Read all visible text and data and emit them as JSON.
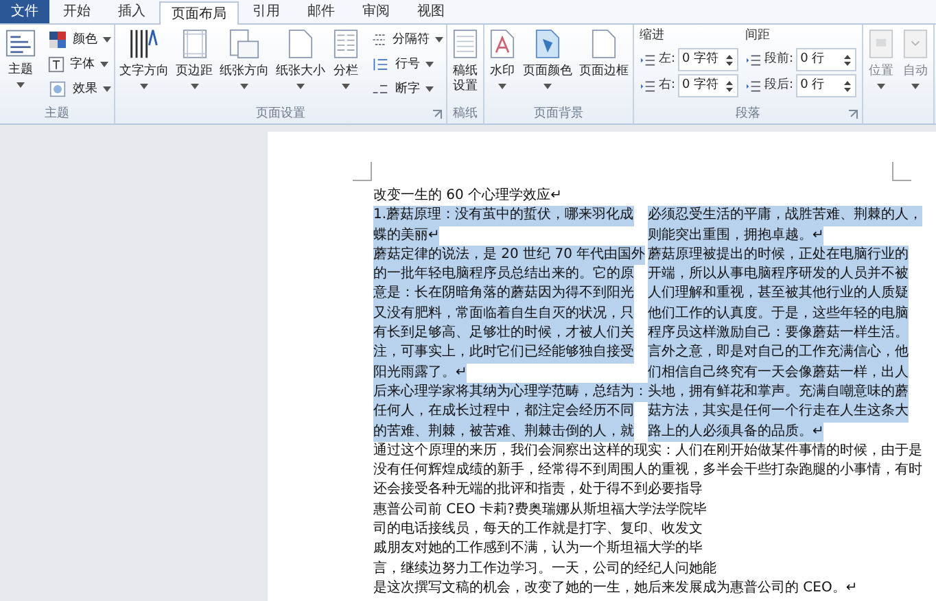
{
  "ribbon": {
    "tabs": [
      {
        "label": "文件",
        "kind": "file",
        "selected": false
      },
      {
        "label": "开始",
        "kind": "tab",
        "selected": false
      },
      {
        "label": "插入",
        "kind": "tab",
        "selected": false
      },
      {
        "label": "页面布局",
        "kind": "tab",
        "selected": true
      },
      {
        "label": "引用",
        "kind": "tab",
        "selected": false
      },
      {
        "label": "邮件",
        "kind": "tab",
        "selected": false
      },
      {
        "label": "审阅",
        "kind": "tab",
        "selected": false
      },
      {
        "label": "视图",
        "kind": "tab",
        "selected": false
      }
    ],
    "groups": [
      {
        "label": "主题",
        "kind": "buttons",
        "items": [
          {
            "label": "主题",
            "kind": "large",
            "dropdown": true,
            "disabled": false
          },
          {
            "label": "颜色",
            "kind": "small",
            "dropdown": true,
            "disabled": false
          },
          {
            "label": "字体",
            "kind": "small",
            "dropdown": true,
            "disabled": false
          },
          {
            "label": "效果",
            "kind": "small",
            "dropdown": true,
            "disabled": false
          }
        ]
      },
      {
        "label": "页面设置",
        "kind": "buttons",
        "launcher": true,
        "items": [
          {
            "label": "文字方向",
            "kind": "large",
            "dropdown": true,
            "disabled": false
          },
          {
            "label": "页边距",
            "kind": "large",
            "dropdown": true,
            "disabled": false
          },
          {
            "label": "纸张方向",
            "kind": "large",
            "dropdown": true,
            "disabled": false
          },
          {
            "label": "纸张大小",
            "kind": "large",
            "dropdown": true,
            "disabled": false
          },
          {
            "label": "分栏",
            "kind": "large",
            "dropdown": true,
            "disabled": false
          },
          {
            "label": "分隔符",
            "kind": "small",
            "dropdown": true,
            "disabled": false
          },
          {
            "label": "行号",
            "kind": "small",
            "dropdown": true,
            "disabled": false
          },
          {
            "label": "断字",
            "kind": "small",
            "dropdown": true,
            "disabled": false
          }
        ]
      },
      {
        "label": "稿纸",
        "kind": "buttons",
        "items": [
          {
            "label": "稿纸设置",
            "kind": "narrow",
            "dropdown": false,
            "disabled": false
          }
        ]
      },
      {
        "label": "页面背景",
        "kind": "buttons",
        "items": [
          {
            "label": "水印",
            "kind": "large",
            "dropdown": true,
            "disabled": false
          },
          {
            "label": "页面颜色",
            "kind": "large",
            "dropdown": true,
            "disabled": false
          },
          {
            "label": "页面边框",
            "kind": "large",
            "dropdown": false,
            "disabled": false
          }
        ]
      },
      {
        "label": "段落",
        "kind": "spacing",
        "launcher": true,
        "sections": [
          {
            "heading": "缩进",
            "fields": [
              {
                "label": "左:",
                "value": "0 字符"
              },
              {
                "label": "右:",
                "value": "0 字符"
              }
            ]
          },
          {
            "heading": "间距",
            "fields": [
              {
                "label": "段前:",
                "value": "0 行"
              },
              {
                "label": "段后:",
                "value": "0 行"
              }
            ]
          }
        ]
      },
      {
        "kind": "buttons",
        "items": [
          {
            "label": "位置",
            "kind": "large",
            "dropdown": true,
            "disabled": true
          },
          {
            "label": "自动",
            "kind": "large",
            "dropdown": true,
            "disabled": true
          }
        ]
      }
    ]
  },
  "document": {
    "title": "改变一生的 60 个心理学效应↵",
    "column_1": [
      {
        "text": "1.蘑菇原理：没有茧中的蜇伏，哪来羽化成",
        "highlighted": true
      },
      {
        "text": "蝶的美丽↵",
        "highlighted": true
      },
      {
        "text": "蘑菇定律的说法，是 20 世纪 70 年代由国外",
        "highlighted": true
      },
      {
        "text": "的一批年轻电脑程序员总结出来的。它的原",
        "highlighted": true
      },
      {
        "text": "意是：长在阴暗角落的蘑菇因为得不到阳光",
        "highlighted": true
      },
      {
        "text": "又没有肥料，常面临着自生自灭的状况，只",
        "highlighted": true
      },
      {
        "text": "有长到足够高、足够壮的时候，才被人们关",
        "highlighted": true
      },
      {
        "text": "注，可事实上，此时它们已经能够独自接受",
        "highlighted": true
      },
      {
        "text": "阳光雨露了。↵",
        "highlighted": true
      },
      {
        "text": "后来心理学家将其纳为心理学范畴，总结为：",
        "highlighted": true
      },
      {
        "text": "任何人，在成长过程中，都注定会经历不同",
        "highlighted": true
      },
      {
        "text": "的苦难、荆棘，被苦难、荆棘击倒的人，就",
        "highlighted": true
      }
    ],
    "column_2": [
      {
        "text": "必须忍受生活的平庸，战胜苦难、荆棘的人，",
        "highlighted": true
      },
      {
        "text": "则能突出重围，拥抱卓越。↵",
        "highlighted": true
      },
      {
        "text": "蘑菇原理被提出的时候，正处在电脑行业的",
        "highlighted": true
      },
      {
        "text": "开端，所以从事电脑程序研发的人员并不被",
        "highlighted": true
      },
      {
        "text": "人们理解和重视，甚至被其他行业的人质疑",
        "highlighted": true
      },
      {
        "text": "他们工作的认真度。于是，这些年轻的电脑",
        "highlighted": true
      },
      {
        "text": "程序员这样激励自己：要像蘑菇一样生活。",
        "highlighted": true
      },
      {
        "text": "言外之意，即是对自己的工作充满信心，他",
        "highlighted": true
      },
      {
        "text": "们相信自己终究有一天会像蘑菇一样，出人",
        "highlighted": true
      },
      {
        "text": "头地，拥有鲜花和掌声。充满自嘲意味的蘑",
        "highlighted": true
      },
      {
        "text": "菇方法，其实是任何一个行走在人生这条大",
        "highlighted": true
      },
      {
        "text": "路上的人必须具备的品质。↵",
        "highlighted": true
      }
    ],
    "body": [
      {
        "text": "通过这个原理的来历，我们会洞察出这样的现实：人们在刚开始做某件事情的时候，由于是",
        "highlighted": false
      },
      {
        "text": "没有任何辉煌成绩的新手，经常得不到周围人的重视，多半会干些打杂跑腿的小事情，有时",
        "highlighted": false
      },
      {
        "text": "还会接受各种无端的批评和指责，处于得不到必要指导",
        "highlighted": false
      },
      {
        "text": "惠普公司前 CEO 卡莉?费奥瑞娜从斯坦福大学法学院毕",
        "highlighted": false
      },
      {
        "text": "司的电话接线员，每天的工作就是打字、复印、收发文",
        "highlighted": false
      },
      {
        "text": "戚朋友对她的工作感到不满，认为一个斯坦福大学的毕",
        "highlighted": false
      },
      {
        "text": "言，继续边努力工作边学习。一天，公司的经纪人问她能",
        "highlighted": false
      },
      {
        "text": "是这次撰写文稿的机会，改变了她的一生，她后来发展成为惠普公司的 CEO。↵",
        "highlighted": false
      }
    ]
  }
}
